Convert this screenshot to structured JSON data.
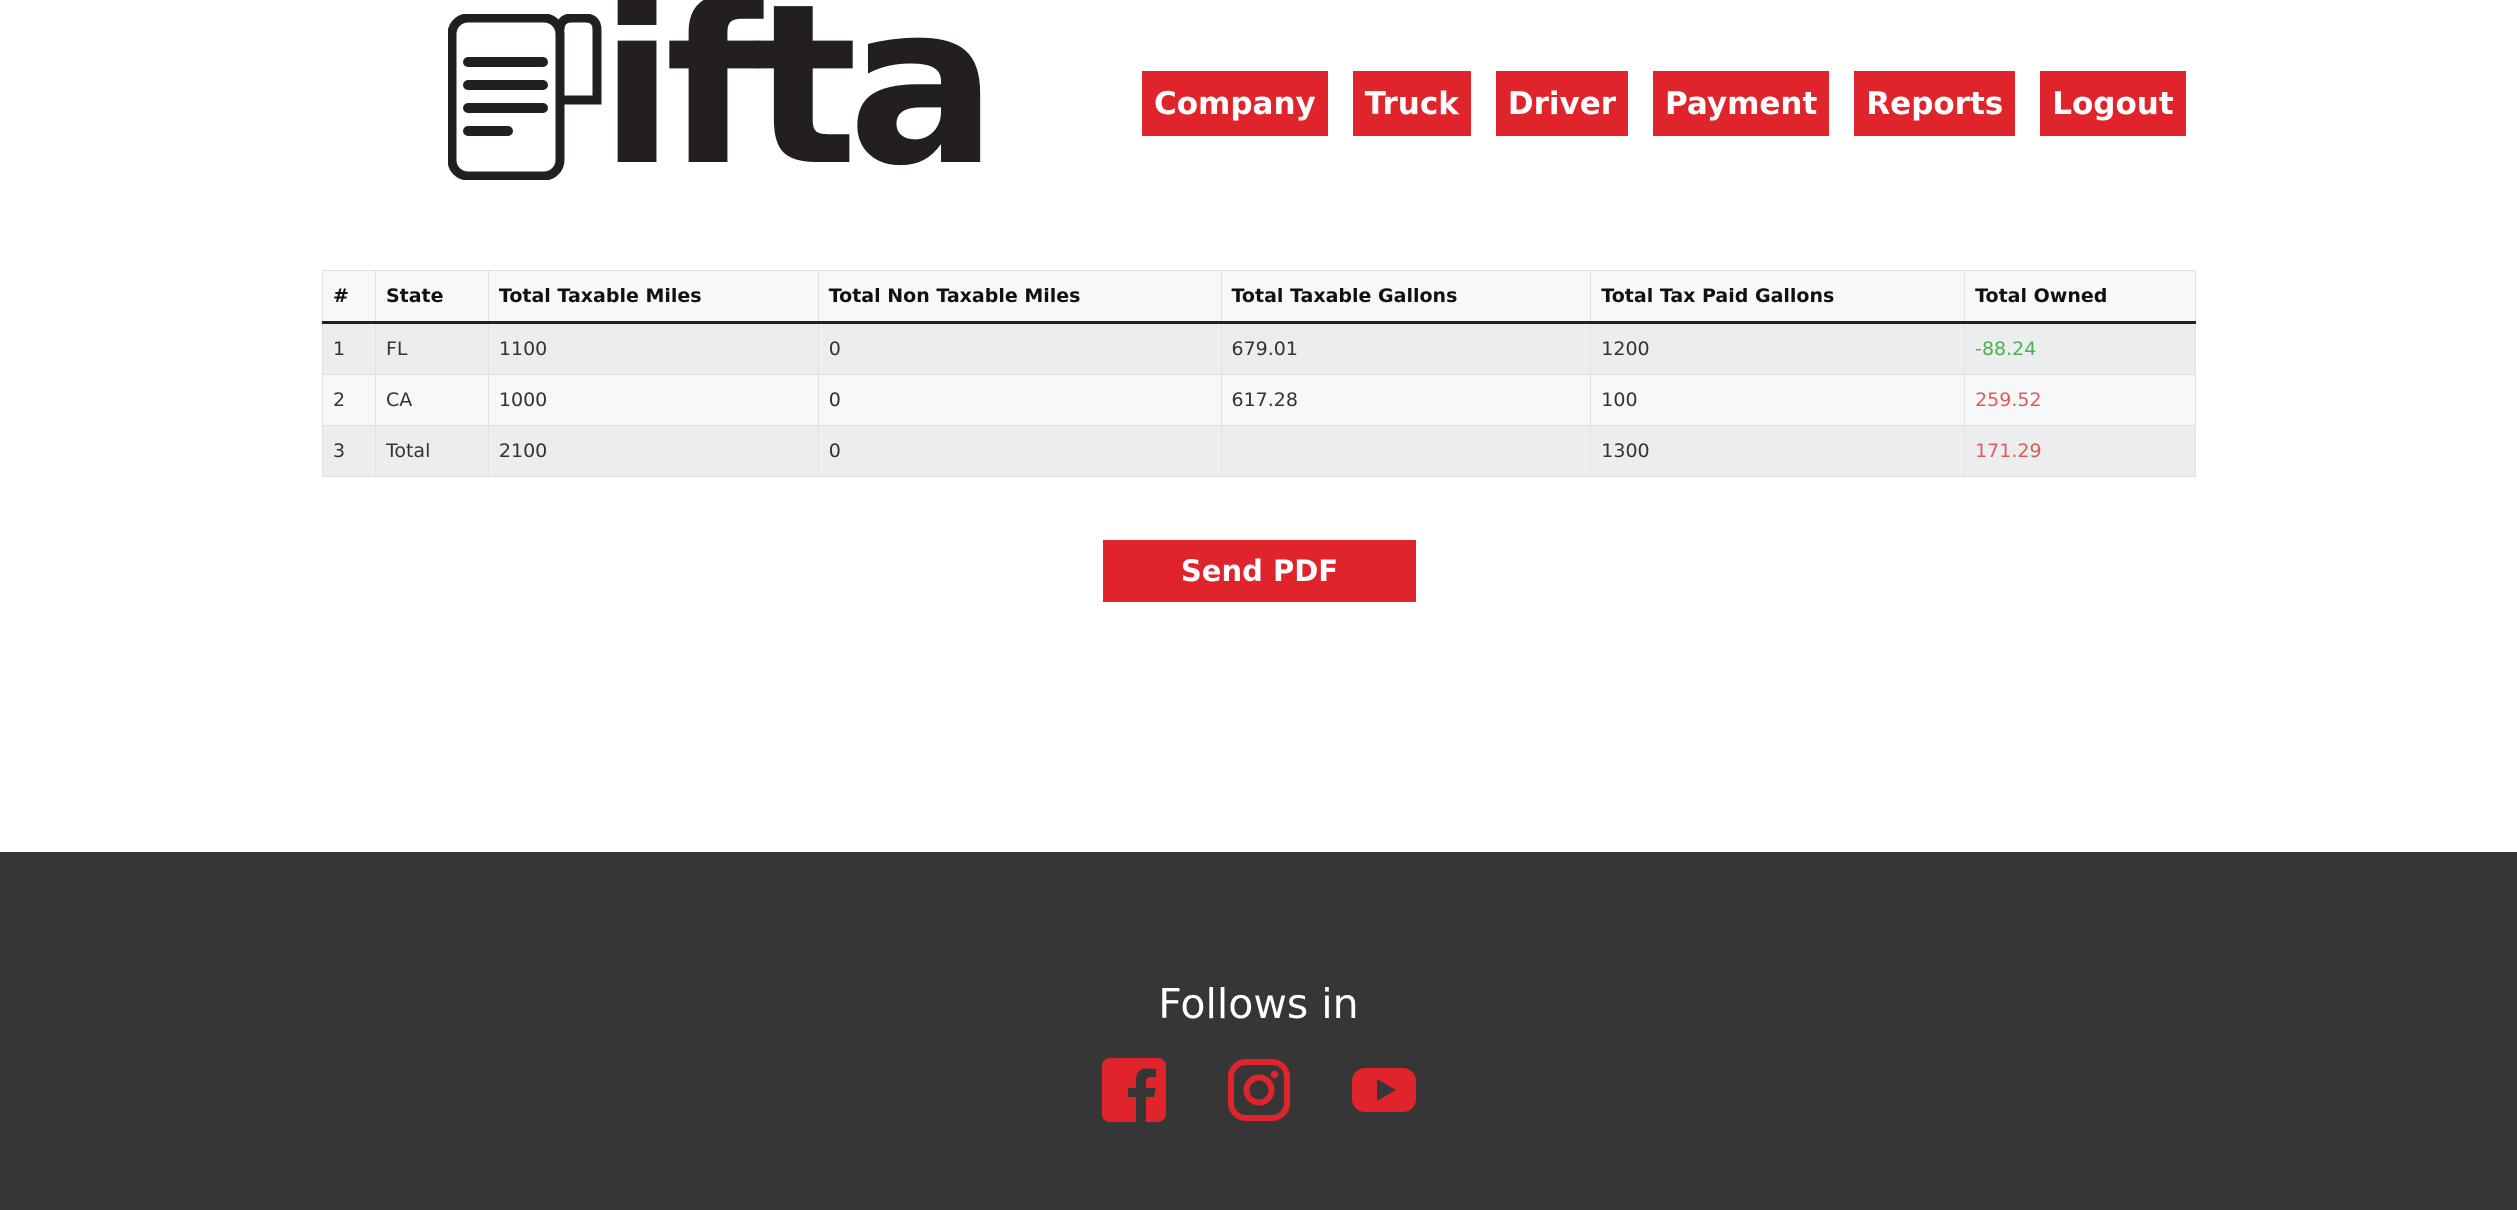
{
  "header": {
    "logo_text": "ifta",
    "nav": [
      {
        "label": "Company"
      },
      {
        "label": "Truck"
      },
      {
        "label": "Driver"
      },
      {
        "label": "Payment"
      },
      {
        "label": "Reports"
      },
      {
        "label": "Logout"
      }
    ]
  },
  "table": {
    "columns": [
      "#",
      "State",
      "Total Taxable Miles",
      "Total Non Taxable Miles",
      "Total Taxable Gallons",
      "Total Tax Paid Gallons",
      "Total Owned"
    ],
    "rows": [
      [
        "1",
        "FL",
        "1100",
        "0",
        "679.01",
        "1200",
        "-88.24"
      ],
      [
        "2",
        "CA",
        "1000",
        "0",
        "617.28",
        "100",
        "259.52"
      ],
      [
        "3",
        "Total",
        "2100",
        "0",
        "",
        "1300",
        "171.29"
      ]
    ]
  },
  "actions": {
    "send_pdf_label": "Send PDF"
  },
  "footer": {
    "follow_title": "Follows in",
    "social_icons": [
      "facebook-icon",
      "instagram-icon",
      "youtube-icon"
    ]
  },
  "colors": {
    "accent": "#e0242c",
    "footer_bg": "#363636",
    "negative_value": "#4caf50",
    "positive_value": "#e05a5a"
  }
}
